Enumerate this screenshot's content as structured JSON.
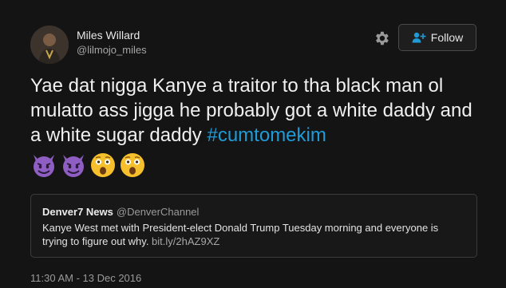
{
  "author": {
    "name": "Miles Willard",
    "handle": "@lilmojo_miles"
  },
  "actions": {
    "settings_icon": "gear-icon",
    "follow_label": "Follow",
    "follow_icon": "add-user-icon"
  },
  "tweet": {
    "text": "Yae dat nigga Kanye a traitor to tha black man ol mulatto ass jigga he probably got a white daddy and a white sugar daddy ",
    "hashtag": "#cumtomekim",
    "emojis": [
      "smiling-imp-icon",
      "smiling-imp-icon",
      "astonished-face-icon",
      "astonished-face-icon"
    ]
  },
  "quote": {
    "name": "Denver7 News",
    "handle": "@DenverChannel",
    "text": "Kanye West met with President-elect Donald Trump Tuesday morning and everyone is trying to figure out why. ",
    "link": "bit.ly/2hAZ9XZ"
  },
  "timestamp": "11:30 AM - 13 Dec 2016",
  "colors": {
    "background": "#141414",
    "hashtag": "#1f9bd8",
    "imp_purple": "#8e5ec2",
    "astonished_yellow": "#f6c02c"
  }
}
